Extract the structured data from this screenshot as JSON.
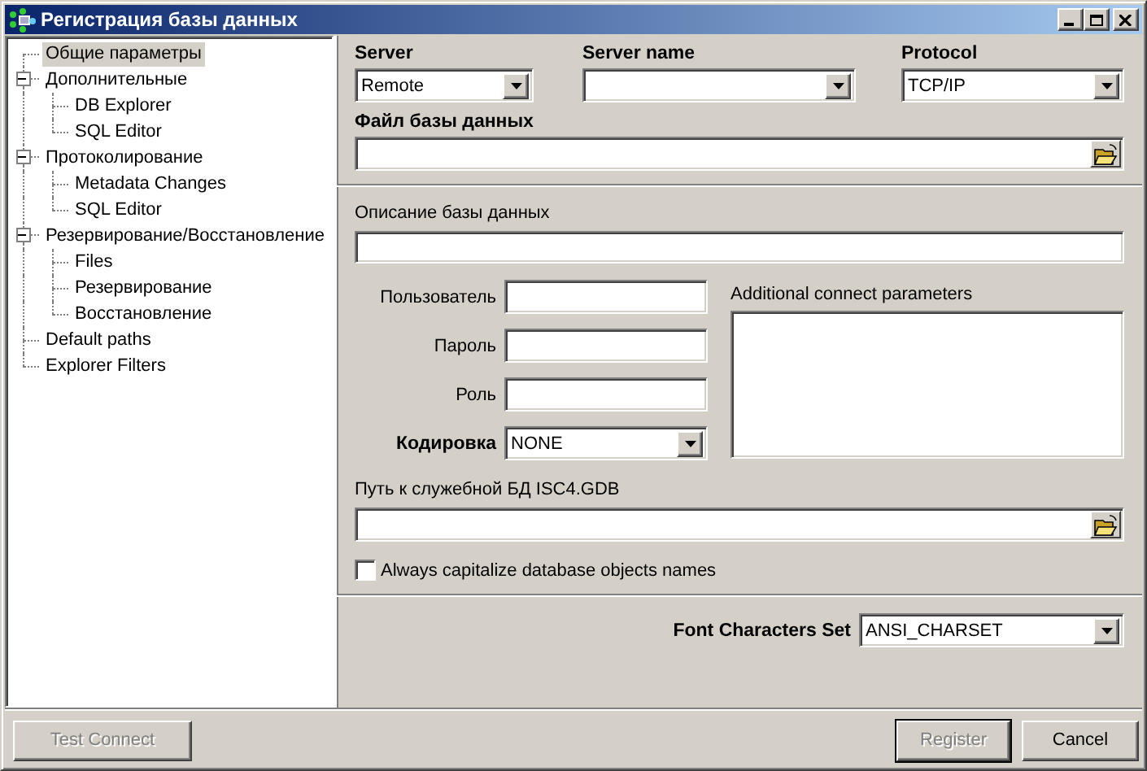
{
  "window": {
    "title": "Регистрация базы данных"
  },
  "tree": [
    {
      "label": "Общие параметры",
      "selected": true
    },
    {
      "label": "Дополнительные",
      "selected": false,
      "expanded": true,
      "children": [
        {
          "label": "DB Explorer",
          "selected": false
        },
        {
          "label": "SQL Editor",
          "selected": false
        }
      ]
    },
    {
      "label": "Протоколирование",
      "selected": false,
      "expanded": true,
      "children": [
        {
          "label": "Metadata Changes",
          "selected": false
        },
        {
          "label": "SQL Editor",
          "selected": false
        }
      ]
    },
    {
      "label": "Резервирование/Восстановление",
      "selected": false,
      "expanded": true,
      "children": [
        {
          "label": "Files",
          "selected": false
        },
        {
          "label": "Резервирование",
          "selected": false
        },
        {
          "label": "Восстановление",
          "selected": false
        }
      ]
    },
    {
      "label": "Default paths",
      "selected": false
    },
    {
      "label": "Explorer Filters",
      "selected": false
    }
  ],
  "server": {
    "label": "Server",
    "value": "Remote"
  },
  "server_name": {
    "label": "Server name"
  },
  "protocol": {
    "label": "Protocol",
    "value": "TCP/IP"
  },
  "database_file": {
    "label": "Файл базы данных"
  },
  "description": {
    "label": "Описание базы данных"
  },
  "user": {
    "label": "Пользователь"
  },
  "password": {
    "label": "Пароль"
  },
  "role": {
    "label": "Роль"
  },
  "charset": {
    "label": "Кодировка",
    "value": "NONE"
  },
  "additional_params": {
    "label": "Additional connect parameters"
  },
  "isc4_path": {
    "label": "Путь к служебной БД ISC4.GDB"
  },
  "capitalize": {
    "label": "Always capitalize database objects names",
    "checked": false
  },
  "font_charset": {
    "label": "Font Characters Set",
    "value": "ANSI_CHARSET"
  },
  "buttons": [
    {
      "label": "Test Connect",
      "disabled": true,
      "default": false
    },
    {
      "label": "Register",
      "disabled": true,
      "default": true
    },
    {
      "label": "Cancel",
      "disabled": false,
      "default": false
    }
  ]
}
